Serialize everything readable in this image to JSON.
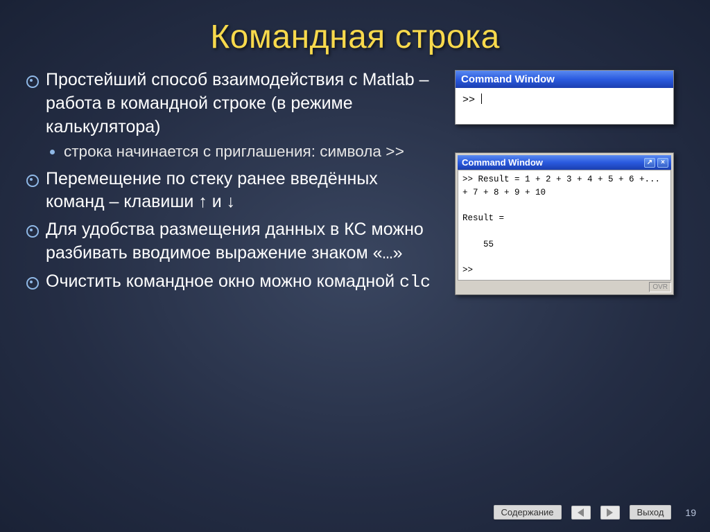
{
  "title": "Командная строка",
  "bullets": {
    "b1_part1": "Простейший способ взаимодействия с Matlab – работа в командной строке (в режиме калькулятора)",
    "b1_sub_part1": "строка начинается с приглашения: символа ",
    "b1_sub_code": ">>",
    "b2": "Перемещение по стеку ранее введённых команд – клавиши ↑ и ↓",
    "b3_part1": "Для удобства размещения данных в КС можно разбивать вводимое выражение знаком «",
    "b3_code": "…",
    "b3_part2": "»",
    "b4_part1": "Очистить командное окно можно комадной ",
    "b4_code": "clc"
  },
  "win1": {
    "title": "Command Window",
    "prompt": ">> "
  },
  "win2": {
    "title": "Command Window",
    "pop_label": "↗",
    "close_label": "×",
    "body": ">> Result = 1 + 2 + 3 + 4 + 5 + 6 +...\n+ 7 + 8 + 9 + 10\n\nResult =\n\n    55\n\n>>",
    "status": "OVR"
  },
  "footer": {
    "contents": "Содержание",
    "exit": "Выход",
    "page": "19"
  }
}
